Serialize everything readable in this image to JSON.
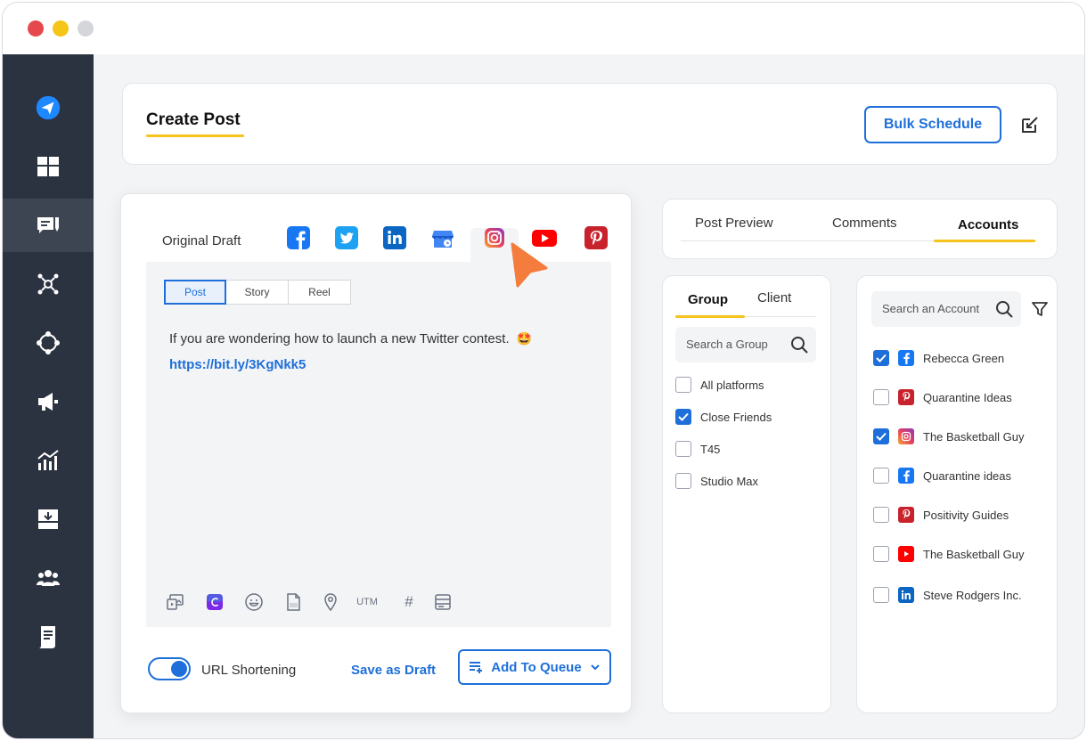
{
  "header": {
    "title": "Create Post",
    "bulk_schedule_label": "Bulk Schedule"
  },
  "editor": {
    "original_draft_label": "Original Draft",
    "networks": [
      "facebook-icon",
      "twitter-icon",
      "linkedin-icon",
      "google-business-icon",
      "instagram-icon",
      "youtube-icon",
      "pinterest-icon"
    ],
    "active_network": "instagram-icon",
    "post_types": [
      "Post",
      "Story",
      "Reel"
    ],
    "active_post_type": "Post",
    "post_text": "If you are wondering how to launch a new Twitter contest.",
    "post_emoji": "🤩",
    "post_link": "https://bit.ly/3KgNkk5",
    "tools": {
      "utm_label": "UTM",
      "hashtag_label": "#"
    },
    "url_shortening_label": "URL Shortening",
    "url_shortening_on": true,
    "save_draft_label": "Save as Draft",
    "add_to_queue_label": "Add To Queue"
  },
  "right_tabs": {
    "items": [
      "Post Preview",
      "Comments",
      "Accounts"
    ],
    "active": "Accounts"
  },
  "groups": {
    "tabs": [
      "Group",
      "Client"
    ],
    "active_tab": "Group",
    "search_placeholder": "Search a Group",
    "items": [
      {
        "label": "All platforms",
        "checked": false
      },
      {
        "label": "Close Friends",
        "checked": true
      },
      {
        "label": "T45",
        "checked": false
      },
      {
        "label": "Studio Max",
        "checked": false
      }
    ]
  },
  "accounts": {
    "search_placeholder": "Search an Account",
    "items": [
      {
        "label": "Rebecca Green",
        "network": "facebook",
        "checked": true
      },
      {
        "label": "Quarantine Ideas",
        "network": "pinterest",
        "checked": false
      },
      {
        "label": "The Basketball Guy",
        "network": "instagram",
        "checked": true
      },
      {
        "label": "Quarantine ideas",
        "network": "facebook",
        "checked": false
      },
      {
        "label": "Positivity Guides",
        "network": "pinterest",
        "checked": false
      },
      {
        "label": "The Basketball Guy",
        "network": "youtube",
        "checked": false
      },
      {
        "label": "Steve Rodgers Inc.",
        "network": "linkedin",
        "checked": false
      }
    ]
  },
  "colors": {
    "accent": "#1e6fd9",
    "highlight": "#f6c21c",
    "sidebar": "#2c3340"
  }
}
